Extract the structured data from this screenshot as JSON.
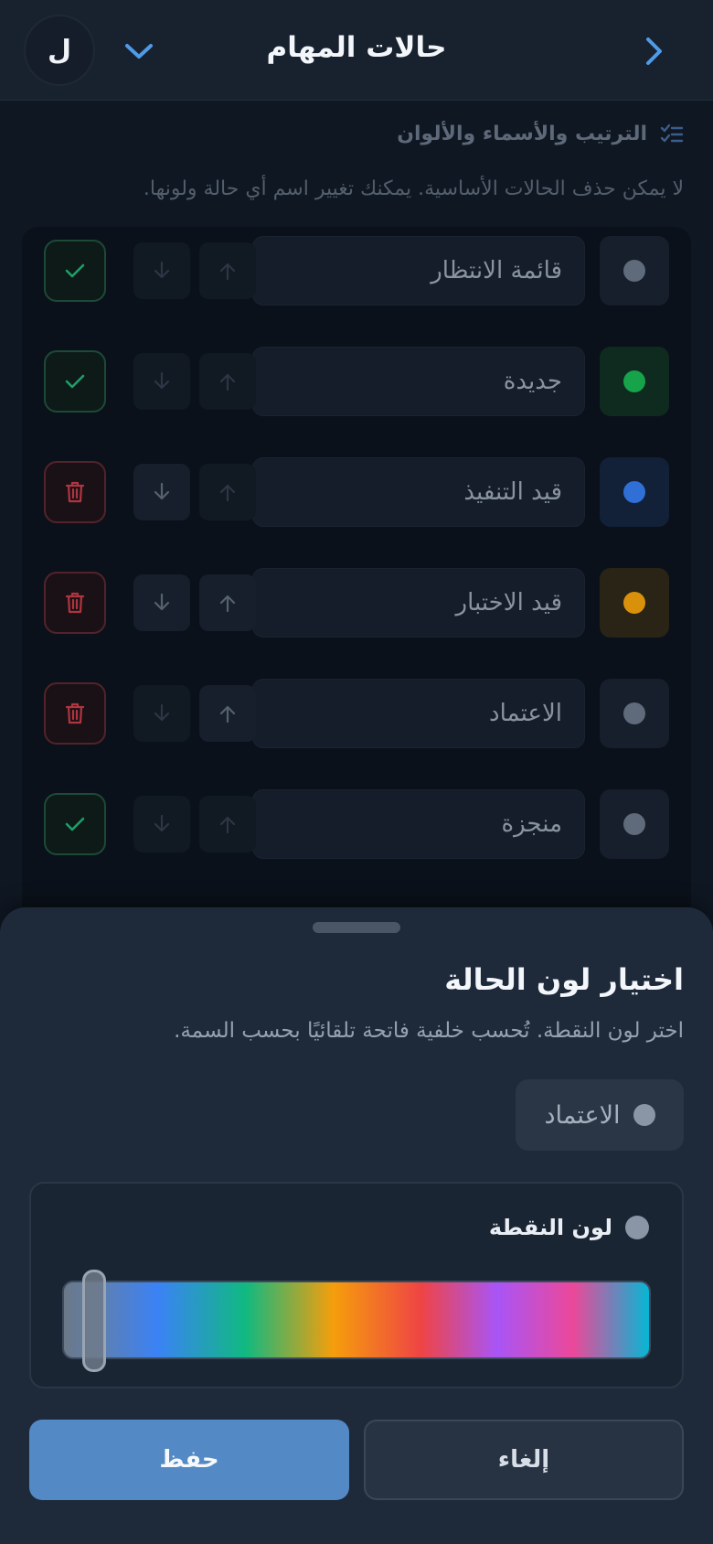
{
  "header": {
    "title": "حالات المهام",
    "avatar_letter": "ل"
  },
  "section": {
    "title": "الترتيب والأسماء والألوان",
    "note": "لا يمكن حذف الحالات الأساسية. يمكنك تغيير اسم أي حالة ولونها."
  },
  "statuses": [
    {
      "name": "قائمة الانتظار",
      "dot_color": "#5f6b7a",
      "box_bg": "#161f2b",
      "up_enabled": false,
      "down_enabled": false,
      "action": "check"
    },
    {
      "name": "جديدة",
      "dot_color": "#16a34a",
      "box_bg": "#0f2a1e",
      "up_enabled": false,
      "down_enabled": false,
      "action": "check"
    },
    {
      "name": "قيد التنفيذ",
      "dot_color": "#2f6fd6",
      "box_bg": "#122138",
      "up_enabled": false,
      "down_enabled": true,
      "action": "trash"
    },
    {
      "name": "قيد الاختبار",
      "dot_color": "#d9910c",
      "box_bg": "#2a2416",
      "up_enabled": true,
      "down_enabled": true,
      "action": "trash"
    },
    {
      "name": "الاعتماد",
      "dot_color": "#5f6b7a",
      "box_bg": "#161f2b",
      "up_enabled": true,
      "down_enabled": false,
      "action": "trash"
    },
    {
      "name": "منجزة",
      "dot_color": "#5f6b7a",
      "box_bg": "#161f2b",
      "up_enabled": false,
      "down_enabled": false,
      "action": "check"
    }
  ],
  "sheet": {
    "title": "اختيار لون الحالة",
    "subtitle": "اختر لون النقطة. تُحسب خلفية فاتحة تلقائيًا بحسب السمة.",
    "preview_label": "الاعتماد",
    "picker_label": "لون النقطة",
    "selected_color": "#8a96a6",
    "hue_position_percent": 3,
    "save_label": "حفظ",
    "cancel_label": "إلغاء"
  },
  "colors": {
    "accent": "#5389c5",
    "check_icon": "#1f9e6a",
    "trash_icon": "#b0353f"
  }
}
